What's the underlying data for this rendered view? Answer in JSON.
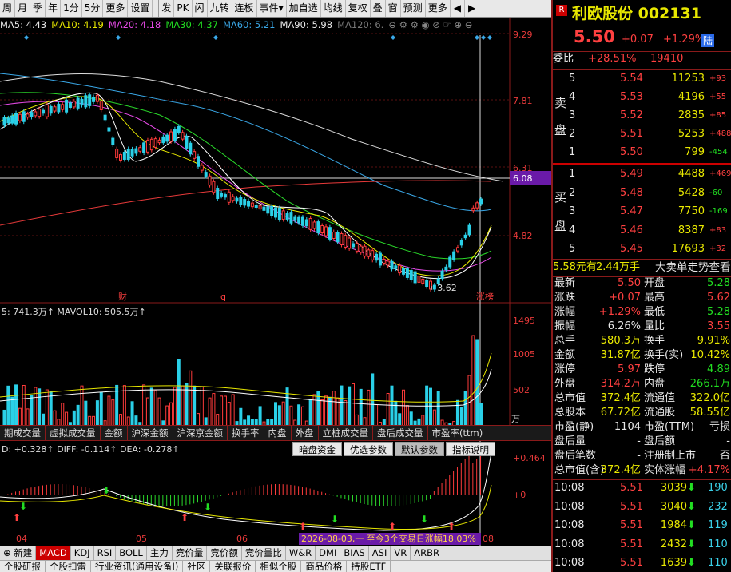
{
  "toolbar": {
    "items": [
      "周",
      "月",
      "季",
      "年",
      "1分",
      "5分",
      "更多",
      "设置"
    ],
    "items2": [
      "发",
      "PK",
      "闪",
      "九转",
      "连板",
      "事件"
    ],
    "items3": [
      "加自选",
      "均线",
      "复权",
      "叠",
      "窗",
      "预测",
      "更多"
    ],
    "arrows": [
      "◀",
      "▶"
    ]
  },
  "ma": {
    "ma5": "MA5: 4.43",
    "ma10": "MA10: 4.19",
    "ma20": "MA20: 4.18",
    "ma30": "MA30: 4.37",
    "ma60": "MA60: 5.21",
    "ma90": "MA90: 5.98",
    "ma120": "MA120: 6."
  },
  "price_axis": [
    "9.29",
    "7.81",
    "6.31",
    "4.82"
  ],
  "crosshair_price": "6.08",
  "low_marker": "3.62",
  "event_markers": [
    "财",
    "q",
    "涨榜"
  ],
  "volume": {
    "header": "5: 741.3万↑  MAVOL10: 505.5万↑",
    "axis": [
      "1495",
      "1005",
      "502"
    ],
    "unit": "万"
  },
  "indicator_tabs": [
    "期成交量",
    "虚拟成交量",
    "金额",
    "沪深金额",
    "沪深京金额",
    "换手率",
    "内盘",
    "外盘",
    "立桩成交量",
    "盘后成交量",
    "市盈率(ttm)"
  ],
  "macd": {
    "header": "D: +0.328↑  DIFF: -0.114↑  DEA: -0.278↑",
    "axis_top": "+0.464",
    "axis_zero": "+0",
    "tabs": [
      "暗盘资金",
      "优选参数",
      "默认参数",
      "指标说明"
    ],
    "active_tab": "默认参数",
    "months": [
      "04",
      "05",
      "06",
      "08"
    ],
    "notice": "2026-08-03,一 至今3个交易日涨幅18.03%"
  },
  "bottom_tabs": [
    "新建",
    "MACD",
    "KDJ",
    "RSI",
    "BOLL",
    "主力",
    "竞价量",
    "竞价额",
    "竞价量比",
    "W&R",
    "DMI",
    "BIAS",
    "ASI",
    "VR",
    "ARBR"
  ],
  "bottom_active": "MACD",
  "bottom_tabs2": [
    "个股研报",
    "个股扫雷",
    "行业资讯(通用设备Ⅰ)",
    "社区",
    "关联报价",
    "相似个股",
    "商品价格",
    "持股ETF"
  ],
  "stock": {
    "badge": "R",
    "name_code": "利欧股份 002131",
    "price": "5.50",
    "change": "+0.07",
    "pct": "+1.29%",
    "tag": "陆",
    "weibi_label": "委比",
    "weibi": "+28.51%",
    "weicha": "19410"
  },
  "sell_label": [
    "卖",
    "盘"
  ],
  "buy_label": [
    "买",
    "盘"
  ],
  "asks": [
    {
      "lv": "5",
      "p": "5.54",
      "v": "11253",
      "d": "+93"
    },
    {
      "lv": "4",
      "p": "5.53",
      "v": "4196",
      "d": "+55"
    },
    {
      "lv": "3",
      "p": "5.52",
      "v": "2835",
      "d": "+85"
    },
    {
      "lv": "2",
      "p": "5.51",
      "v": "5253",
      "d": "+488"
    },
    {
      "lv": "1",
      "p": "5.50",
      "v": "799",
      "d": "-454"
    }
  ],
  "bids": [
    {
      "lv": "1",
      "p": "5.49",
      "v": "4488",
      "d": "+469"
    },
    {
      "lv": "2",
      "p": "5.48",
      "v": "5428",
      "d": "-60"
    },
    {
      "lv": "3",
      "p": "5.47",
      "v": "7750",
      "d": "-169"
    },
    {
      "lv": "4",
      "p": "5.46",
      "p_": "",
      "v": "8387",
      "d": "+83"
    },
    {
      "lv": "5",
      "p": "5.45",
      "v": "17693",
      "d": "+32"
    }
  ],
  "big_order": {
    "price": "5.58元有",
    "vol": "2.44万手",
    "link": "大卖单走势查看"
  },
  "stats": [
    {
      "l1": "最新",
      "v1": "5.50",
      "c1": "r",
      "l2": "开盘",
      "v2": "5.28",
      "c2": "g"
    },
    {
      "l1": "涨跌",
      "v1": "+0.07",
      "c1": "r",
      "l2": "最高",
      "v2": "5.62",
      "c2": "r"
    },
    {
      "l1": "涨幅",
      "v1": "+1.29%",
      "c1": "r",
      "l2": "最低",
      "v2": "5.28",
      "c2": "g"
    },
    {
      "l1": "振幅",
      "v1": "6.26%",
      "c1": "w",
      "l2": "量比",
      "v2": "3.55",
      "c2": "r"
    },
    {
      "l1": "总手",
      "v1": "580.3万",
      "c1": "y",
      "l2": "换手",
      "v2": "9.91%",
      "c2": "y"
    },
    {
      "l1": "金额",
      "v1": "31.87亿",
      "c1": "y",
      "l2": "换手(实)",
      "v2": "10.42%",
      "c2": "y"
    },
    {
      "l1": "涨停",
      "v1": "5.97",
      "c1": "r",
      "l2": "跌停",
      "v2": "4.89",
      "c2": "g"
    },
    {
      "l1": "外盘",
      "v1": "314.2万",
      "c1": "r",
      "l2": "内盘",
      "v2": "266.1万",
      "c2": "g"
    },
    {
      "l1": "总市值",
      "v1": "372.4亿",
      "c1": "y",
      "l2": "流通值",
      "v2": "322.0亿",
      "c2": "y"
    },
    {
      "l1": "总股本",
      "v1": "67.72亿",
      "c1": "y",
      "l2": "流通股",
      "v2": "58.55亿",
      "c2": "y"
    },
    {
      "l1": "市盈(静)",
      "v1": "1104",
      "c1": "w",
      "l2": "市盈(TTM)",
      "v2": "亏损",
      "c2": "w"
    },
    {
      "l1": "盘后量",
      "v1": "-",
      "c1": "w",
      "l2": "盘后额",
      "v2": "-",
      "c2": "w"
    },
    {
      "l1": "盘后笔数",
      "v1": "-",
      "c1": "w",
      "l2": "注册制上市",
      "v2": "否",
      "c2": "w"
    },
    {
      "l1": "总市值(含)",
      "v1": "372.4亿",
      "c1": "y",
      "l2": "实体涨幅",
      "v2": "+4.17%",
      "c2": "r"
    }
  ],
  "ticks": [
    {
      "t": "10:08",
      "p": "5.51",
      "v": "3039",
      "dir": "down",
      "n": "190"
    },
    {
      "t": "10:08",
      "p": "5.51",
      "v": "3040",
      "dir": "down",
      "n": "232"
    },
    {
      "t": "10:08",
      "p": "5.51",
      "v": "1984",
      "dir": "down",
      "n": "119"
    },
    {
      "t": "10:08",
      "p": "5.51",
      "v": "2432",
      "dir": "down",
      "n": "110"
    },
    {
      "t": "10:08",
      "p": "5.51",
      "v": "1639",
      "dir": "down",
      "n": "110"
    }
  ],
  "colors": {
    "up": "#ff3b3b",
    "down": "#2ad0e8",
    "bg": "#000000",
    "border": "#8a1a1a"
  }
}
